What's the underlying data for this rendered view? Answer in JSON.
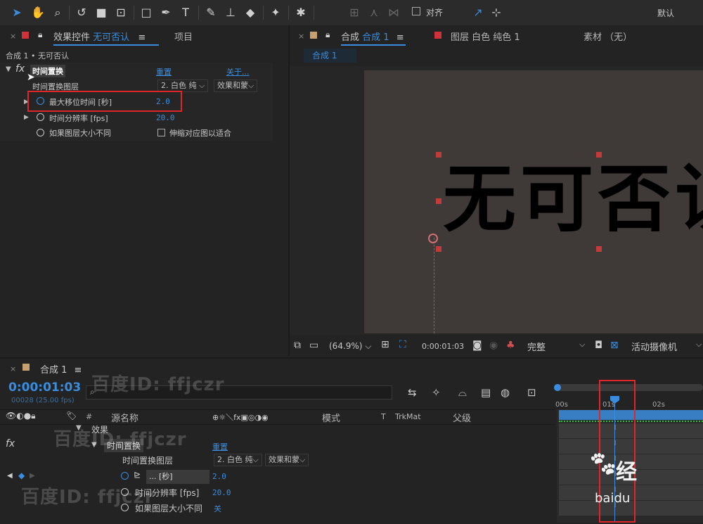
{
  "toolbar": {
    "align_label": "对齐",
    "workspace_label": "默认"
  },
  "effects_panel": {
    "tab_label_prefix": "效果控件",
    "tab_label_layer": "无可否认",
    "menu_icon": "≡",
    "project_tab": "项目",
    "breadcrumb": "合成 1 • 无可否认",
    "effect_name": "时间置换",
    "reset": "重置",
    "about": "关于...",
    "rows": [
      {
        "label": "时间置换图层",
        "value": "2. 白色 纯",
        "extra": "效果和蒙"
      },
      {
        "label": "最大移位时间 [秒]",
        "value": "2.0"
      },
      {
        "label": "时间分辨率 [fps]",
        "value": "20.0"
      },
      {
        "label": "如果图层大小不同",
        "value": "伸缩对应图以适合"
      }
    ]
  },
  "comp_panel": {
    "tab_prefix": "合成",
    "tab_name": "合成 1",
    "menu_icon": "≡",
    "layer_tab": "图层 白色 纯色 1",
    "footage_tab": "素材 （无）",
    "flow_tab": "合成 1",
    "canvas_text": [
      "无",
      "可",
      "否",
      "认"
    ],
    "zoom": "(64.9%)",
    "timecode": "0:00:01:03",
    "quality": "完整",
    "camera": "活动摄像机"
  },
  "timeline": {
    "tab_label": "合成 1",
    "menu_icon": "≡",
    "timecode": "0:00:01:03",
    "frame_info": "00028 (25.00 fps)",
    "search_placeholder": "",
    "columns": {
      "hash": "#",
      "source_name": "源名称",
      "mode": "模式",
      "t": "T",
      "trkmat": "TrkMat",
      "parent": "父级"
    },
    "ruler": [
      "00s",
      "01s",
      "02s"
    ],
    "rows": [
      {
        "label": "效果"
      },
      {
        "label": "时间置换",
        "value": "重置"
      },
      {
        "label": "时间置换图层",
        "value": "2. 白色 纯",
        "extra": "效果和蒙"
      },
      {
        "label": "... [秒]",
        "value": "2.0"
      },
      {
        "label": "时间分辨率 [fps]",
        "value": "20.0"
      },
      {
        "label": "如果图层大小不同",
        "value": "关"
      }
    ]
  },
  "watermarks": [
    "百度ID: ffjczr",
    "百度ID: ffjczr",
    "百度ID: ffjczr"
  ],
  "baidu_logo": "baidu",
  "baidu_logo_mark": "经",
  "colors": {
    "accent": "#3a8dde",
    "highlight": "#e0262b",
    "bg": "#232323",
    "canvas": "#3f3938"
  }
}
